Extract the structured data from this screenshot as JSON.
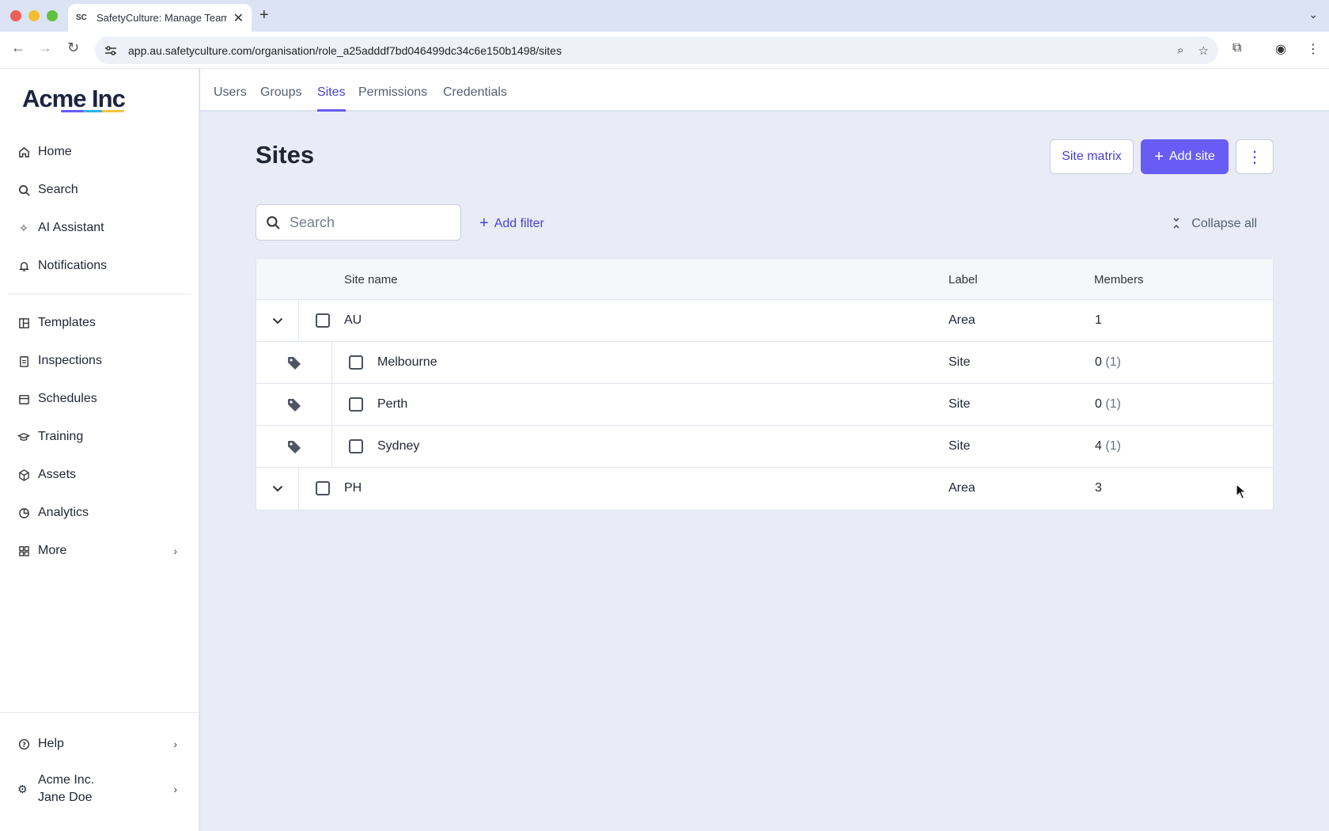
{
  "browser": {
    "tab_title": "SafetyCulture: Manage Teams",
    "favicon_text": "SC",
    "url": "app.au.safetyculture.com/organisation/role_a25adddf7bd046499dc34c6e150b1498/sites"
  },
  "sidebar": {
    "logo": "Acme Inc",
    "items": [
      {
        "label": "Home",
        "icon": "home-icon"
      },
      {
        "label": "Search",
        "icon": "search-icon"
      },
      {
        "label": "AI Assistant",
        "icon": "sparkle-icon"
      },
      {
        "label": "Notifications",
        "icon": "bell-icon"
      },
      {
        "label": "Templates",
        "icon": "template-icon"
      },
      {
        "label": "Inspections",
        "icon": "clipboard-icon"
      },
      {
        "label": "Schedules",
        "icon": "calendar-icon"
      },
      {
        "label": "Training",
        "icon": "graduation-cap-icon"
      },
      {
        "label": "Assets",
        "icon": "cube-icon"
      },
      {
        "label": "Analytics",
        "icon": "pie-chart-icon"
      },
      {
        "label": "More",
        "icon": "grid-icon"
      }
    ],
    "help": "Help",
    "org_name": "Acme Inc.",
    "user_name": "Jane Doe"
  },
  "topnav": {
    "tabs": [
      "Users",
      "Groups",
      "Sites",
      "Permissions",
      "Credentials"
    ],
    "active": "Sites"
  },
  "page": {
    "title": "Sites",
    "site_matrix_label": "Site matrix",
    "add_site_label": "Add site",
    "search_placeholder": "Search",
    "add_filter_label": "Add filter",
    "collapse_all_label": "Collapse all"
  },
  "table": {
    "columns": [
      "Site name",
      "Label",
      "Members"
    ],
    "rows": [
      {
        "name": "AU",
        "label": "Area",
        "members": "1",
        "inherited": "",
        "type": "area"
      },
      {
        "name": "Melbourne",
        "label": "Site",
        "members": "0",
        "inherited": "(1)",
        "type": "site"
      },
      {
        "name": "Perth",
        "label": "Site",
        "members": "0",
        "inherited": "(1)",
        "type": "site"
      },
      {
        "name": "Sydney",
        "label": "Site",
        "members": "4",
        "inherited": "(1)",
        "type": "site"
      },
      {
        "name": "PH",
        "label": "Area",
        "members": "3",
        "inherited": "",
        "type": "area"
      }
    ]
  },
  "colors": {
    "accent": "#675df4",
    "accent_text": "#4740d4",
    "content_bg": "#e9ecf7"
  }
}
